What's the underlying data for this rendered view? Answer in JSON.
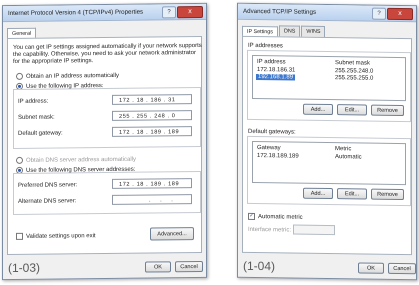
{
  "left": {
    "title": "Internet Protocol Version 4 (TCP/IPv4) Properties",
    "help": "?",
    "close": "x",
    "tab_general": "General",
    "description": [
      "You can get IP settings assigned automatically if your network supports",
      "the capability. Otherwise, you need to ask your network administrator",
      "for the appropriate IP settings."
    ],
    "radio_auto_ip": "Obtain an IP address automatically",
    "radio_manual_ip": "Use the following IP address:",
    "ip_label": "IP address:",
    "ip_value": "172 . 18 . 186 . 31",
    "mask_label": "Subnet mask:",
    "mask_value": "255 . 255 . 248 . 0",
    "gateway_label": "Default gateway:",
    "gateway_value": "172 . 18 . 189 . 189",
    "radio_auto_dns": "Obtain DNS server address automatically",
    "radio_manual_dns": "Use the following DNS server addresses:",
    "pref_dns_label": "Preferred DNS server:",
    "pref_dns_value": "172 . 18 . 189 . 189",
    "alt_dns_label": "Alternate DNS server:",
    "alt_dns_value": ". . .",
    "validate": "Validate settings upon exit",
    "advanced": "Advanced...",
    "ok": "OK",
    "cancel": "Cancel",
    "caption": "(1-03)"
  },
  "right": {
    "title": "Advanced TCP/IP Settings",
    "help": "?",
    "close": "x",
    "tabs": [
      "IP Settings",
      "DNS",
      "WINS"
    ],
    "ip_group": "IP addresses",
    "col_ip": "IP address",
    "col_mask": "Subnet mask",
    "rows": [
      {
        "ip": "172.18.186.31",
        "mask": "255.255.248.0"
      },
      {
        "ip": "192.168.1.89",
        "mask": "255.255.255.0"
      }
    ],
    "add": "Add...",
    "edit": "Edit...",
    "remove": "Remove",
    "gw_group": "Default gateways:",
    "col_gateway": "Gateway",
    "col_metric": "Metric",
    "gw_rows": [
      {
        "gateway": "172.18.189.189",
        "metric": "Automatic"
      }
    ],
    "auto_metric": "Automatic metric",
    "iface_metric": "Interface metric:",
    "ok": "OK",
    "cancel": "Cancel",
    "caption": "(1-04)"
  }
}
